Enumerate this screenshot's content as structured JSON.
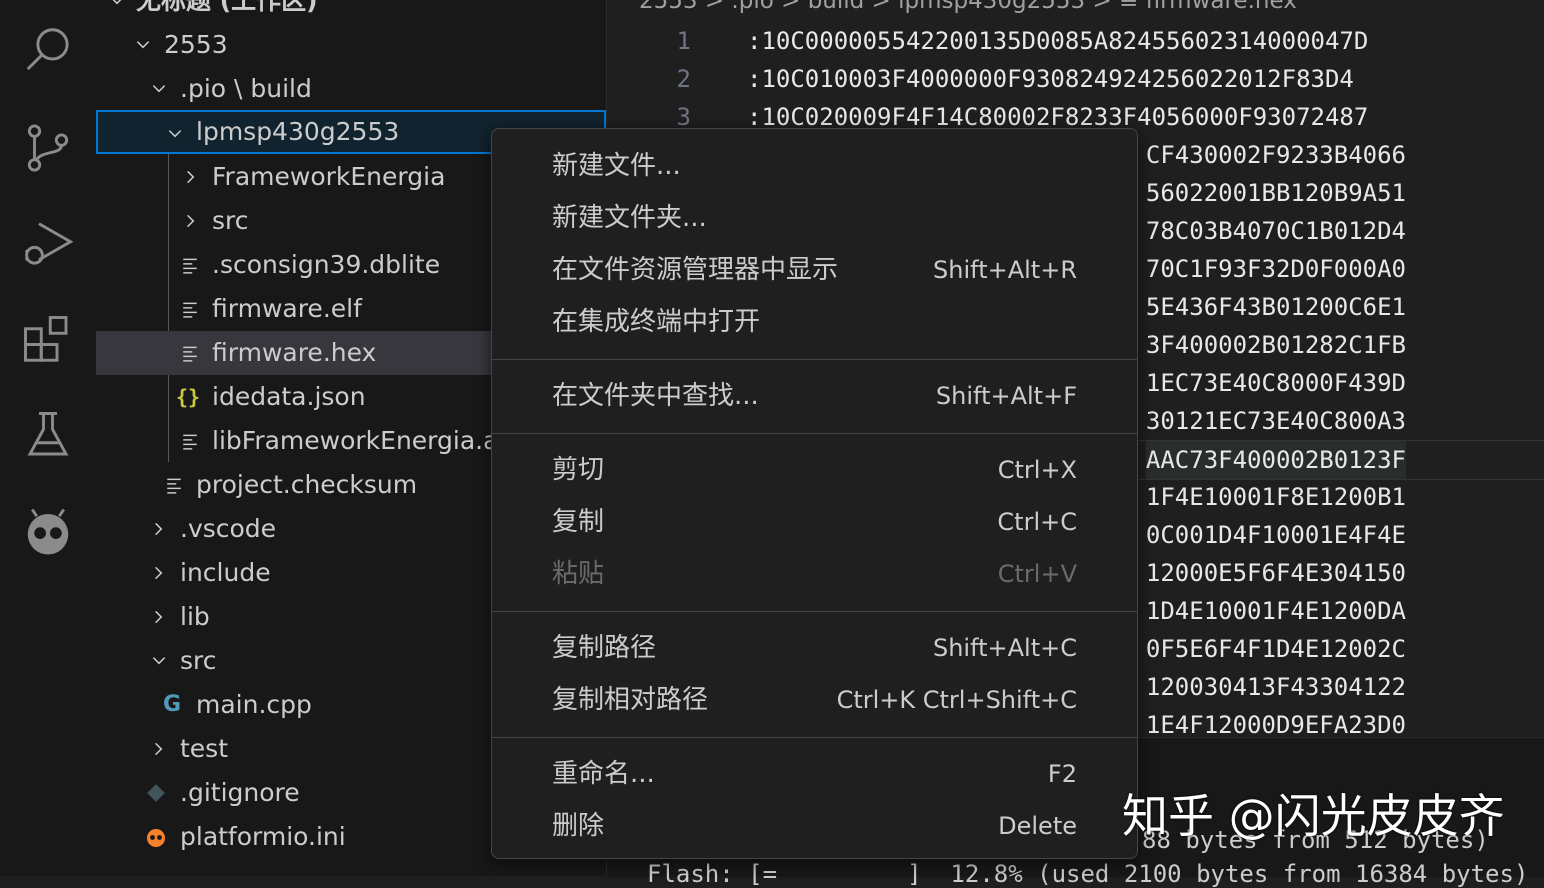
{
  "explorer": {
    "workspace_title": "无标题 (工作区)",
    "items": [
      {
        "label": "2553"
      },
      {
        "label": ".pio \\ build"
      },
      {
        "label": "lpmsp430g2553"
      },
      {
        "label": "FrameworkEnergia"
      },
      {
        "label": "src"
      },
      {
        "label": ".sconsign39.dblite"
      },
      {
        "label": "firmware.elf"
      },
      {
        "label": "firmware.hex"
      },
      {
        "label": "idedata.json"
      },
      {
        "label": "libFrameworkEnergia.a"
      },
      {
        "label": "project.checksum"
      },
      {
        "label": ".vscode"
      },
      {
        "label": "include"
      },
      {
        "label": "lib"
      },
      {
        "label": "src"
      },
      {
        "label": "main.cpp"
      },
      {
        "label": "test"
      },
      {
        "label": ".gitignore"
      },
      {
        "label": "platformio.ini"
      }
    ]
  },
  "editor": {
    "breadcrumb": "2553 > .pio > build > lpmsp430g2553 > ≡ firmware.hex",
    "lines": [
      {
        "num": "1",
        "text": ":10C000005542200135D0085A82455602314000047D"
      },
      {
        "num": "2",
        "text": ":10C010003F4000000F930824924256022012F83D4"
      },
      {
        "num": "3",
        "text": ":10C020009F4F14C80002F8233F4056000F93072487"
      },
      {
        "num": "",
        "text": "CF430002F9233B4066"
      },
      {
        "num": "",
        "text": "56022001BB120B9A51"
      },
      {
        "num": "",
        "text": "78C03B4070C1B012D4"
      },
      {
        "num": "",
        "text": "70C1F93F32D0F000A0"
      },
      {
        "num": "",
        "text": "5E436F43B01200C6E1"
      },
      {
        "num": "",
        "text": "3F400002B01282C1FB"
      },
      {
        "num": "",
        "text": "1EC73E40C8000F439D"
      },
      {
        "num": "",
        "text": "30121EC73E40C800A3"
      },
      {
        "num": "",
        "text": "AAC73F400002B0123F"
      },
      {
        "num": "",
        "text": "1F4E10001F8E1200B1"
      },
      {
        "num": "",
        "text": "0C001D4F10001E4F4E"
      },
      {
        "num": "",
        "text": "12000E5F6F4E304150"
      },
      {
        "num": "",
        "text": "1D4E10001F4E1200DA"
      },
      {
        "num": "",
        "text": "0F5E6F4F1D4E12002C"
      },
      {
        "num": "",
        "text": "120030413F43304122"
      },
      {
        "num": "",
        "text": "1E4F12000D9EFA23D0"
      }
    ]
  },
  "terminal": {
    "line1": "88 bytes from 512 bytes)",
    "line2": "Flash: [=         ]  12.8% (used 2100 bytes from 16384 bytes)"
  },
  "context_menu": {
    "groups": [
      [
        {
          "label": "新建文件...",
          "key": ""
        },
        {
          "label": "新建文件夹...",
          "key": ""
        },
        {
          "label": "在文件资源管理器中显示",
          "key": "Shift+Alt+R"
        },
        {
          "label": "在集成终端中打开",
          "key": ""
        }
      ],
      [
        {
          "label": "在文件夹中查找...",
          "key": "Shift+Alt+F"
        }
      ],
      [
        {
          "label": "剪切",
          "key": "Ctrl+X"
        },
        {
          "label": "复制",
          "key": "Ctrl+C"
        },
        {
          "label": "粘贴",
          "key": "Ctrl+V",
          "disabled": true
        }
      ],
      [
        {
          "label": "复制路径",
          "key": "Shift+Alt+C"
        },
        {
          "label": "复制相对路径",
          "key": "Ctrl+K Ctrl+Shift+C"
        }
      ],
      [
        {
          "label": "重命名...",
          "key": "F2"
        },
        {
          "label": "删除",
          "key": "Delete"
        }
      ]
    ]
  },
  "watermark": "知乎 @闪光皮皮齐",
  "colors": {
    "accent": "#0078d4",
    "json_icon": "#cbcb41",
    "cpp_icon": "#519aba",
    "git_icon": "#41535b",
    "platformio_icon": "#f5822a"
  },
  "icons": {
    "activity": [
      "search-icon",
      "source-control-icon",
      "run-debug-icon",
      "extensions-icon",
      "testing-icon",
      "platformio-icon"
    ]
  }
}
